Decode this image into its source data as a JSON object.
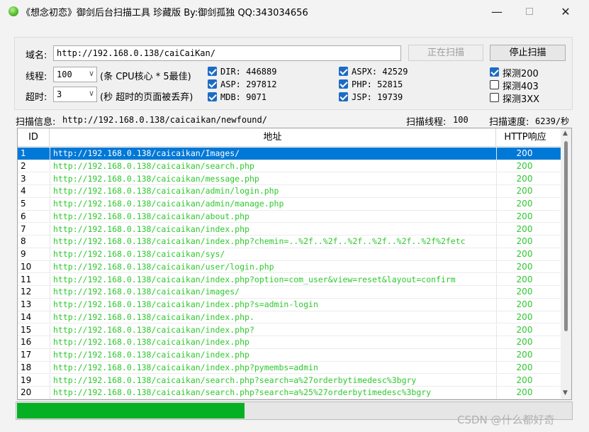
{
  "window": {
    "title": "《想念初恋》御剑后台扫描工具 珍藏版 By:御剑孤独 QQ:343034656",
    "minimize_glyph": "—",
    "close_glyph": "✕"
  },
  "form": {
    "domain_label": "域名:",
    "domain_value": "http://192.168.0.138/caiCaiKan/",
    "scan_button": "正在扫描",
    "stop_button": "停止扫描",
    "threads_label": "线程:",
    "threads_value": "100",
    "threads_hint": "(条 CPU核心 * 5最佳)",
    "timeout_label": "超时:",
    "timeout_value": "3",
    "timeout_hint": "(秒 超时的页面被丢弃)",
    "dicts": [
      {
        "label": "DIR: 446889",
        "checked": true
      },
      {
        "label": "ASP: 297812",
        "checked": true
      },
      {
        "label": "MDB: 9071",
        "checked": true
      },
      {
        "label": "ASPX: 42529",
        "checked": true
      },
      {
        "label": "PHP: 52815",
        "checked": true
      },
      {
        "label": "JSP: 19739",
        "checked": true
      }
    ],
    "probes": [
      {
        "label": "探测200",
        "checked": true
      },
      {
        "label": "探测403",
        "checked": false
      },
      {
        "label": "探测3XX",
        "checked": false
      }
    ]
  },
  "status": {
    "info_label": "扫描信息:",
    "info_value": "http://192.168.0.138/caicaikan/newfound/",
    "threads_label": "扫描线程:",
    "threads_value": "100",
    "speed_label": "扫描速度:",
    "speed_value": "6239/秒"
  },
  "table": {
    "columns": [
      "ID",
      "地址",
      "HTTP响应"
    ],
    "selected_index": 0,
    "rows": [
      {
        "id": "1",
        "url": "http://192.168.0.138/caicaikan/Images/",
        "code": "200"
      },
      {
        "id": "2",
        "url": "http://192.168.0.138/caicaikan/search.php",
        "code": "200"
      },
      {
        "id": "3",
        "url": "http://192.168.0.138/caicaikan/message.php",
        "code": "200"
      },
      {
        "id": "4",
        "url": "http://192.168.0.138/caicaikan/admin/login.php",
        "code": "200"
      },
      {
        "id": "5",
        "url": "http://192.168.0.138/caicaikan/admin/manage.php",
        "code": "200"
      },
      {
        "id": "6",
        "url": "http://192.168.0.138/caicaikan/about.php",
        "code": "200"
      },
      {
        "id": "7",
        "url": "http://192.168.0.138/caicaikan/index.php",
        "code": "200"
      },
      {
        "id": "8",
        "url": "http://192.168.0.138/caicaikan/index.php?chemin=..%2f..%2f..%2f..%2f..%2f..%2f%2fetc",
        "code": "200"
      },
      {
        "id": "9",
        "url": "http://192.168.0.138/caicaikan/sys/",
        "code": "200"
      },
      {
        "id": "10",
        "url": "http://192.168.0.138/caicaikan/user/login.php",
        "code": "200"
      },
      {
        "id": "11",
        "url": "http://192.168.0.138/caicaikan/index.php?option=com_user&view=reset&layout=confirm",
        "code": "200"
      },
      {
        "id": "12",
        "url": "http://192.168.0.138/caicaikan/images/",
        "code": "200"
      },
      {
        "id": "13",
        "url": "http://192.168.0.138/caicaikan/index.php?s=admin-login",
        "code": "200"
      },
      {
        "id": "14",
        "url": "http://192.168.0.138/caicaikan/index.php.",
        "code": "200"
      },
      {
        "id": "15",
        "url": "http://192.168.0.138/caicaikan/index.php?",
        "code": "200"
      },
      {
        "id": "16",
        "url": "http://192.168.0.138/caicaikan/index.php",
        "code": "200"
      },
      {
        "id": "17",
        "url": "http://192.168.0.138/caicaikan/index.php",
        "code": "200"
      },
      {
        "id": "18",
        "url": "http://192.168.0.138/caicaikan/index.php?pymembs=admin",
        "code": "200"
      },
      {
        "id": "19",
        "url": "http://192.168.0.138/caicaikan/search.php?search=a%27orderbytimedesc%3bgry",
        "code": "200"
      },
      {
        "id": "20",
        "url": "http://192.168.0.138/caicaikan/search.php?search=a%25%27orderbytimedesc%3bgry",
        "code": "200"
      }
    ]
  },
  "progress": {
    "fraction": 0.41,
    "color": "#06b025"
  },
  "watermark": "CSDN @什么都好奇",
  "colors": {
    "url_text": "#2ec82e",
    "selection": "#0078d7"
  }
}
